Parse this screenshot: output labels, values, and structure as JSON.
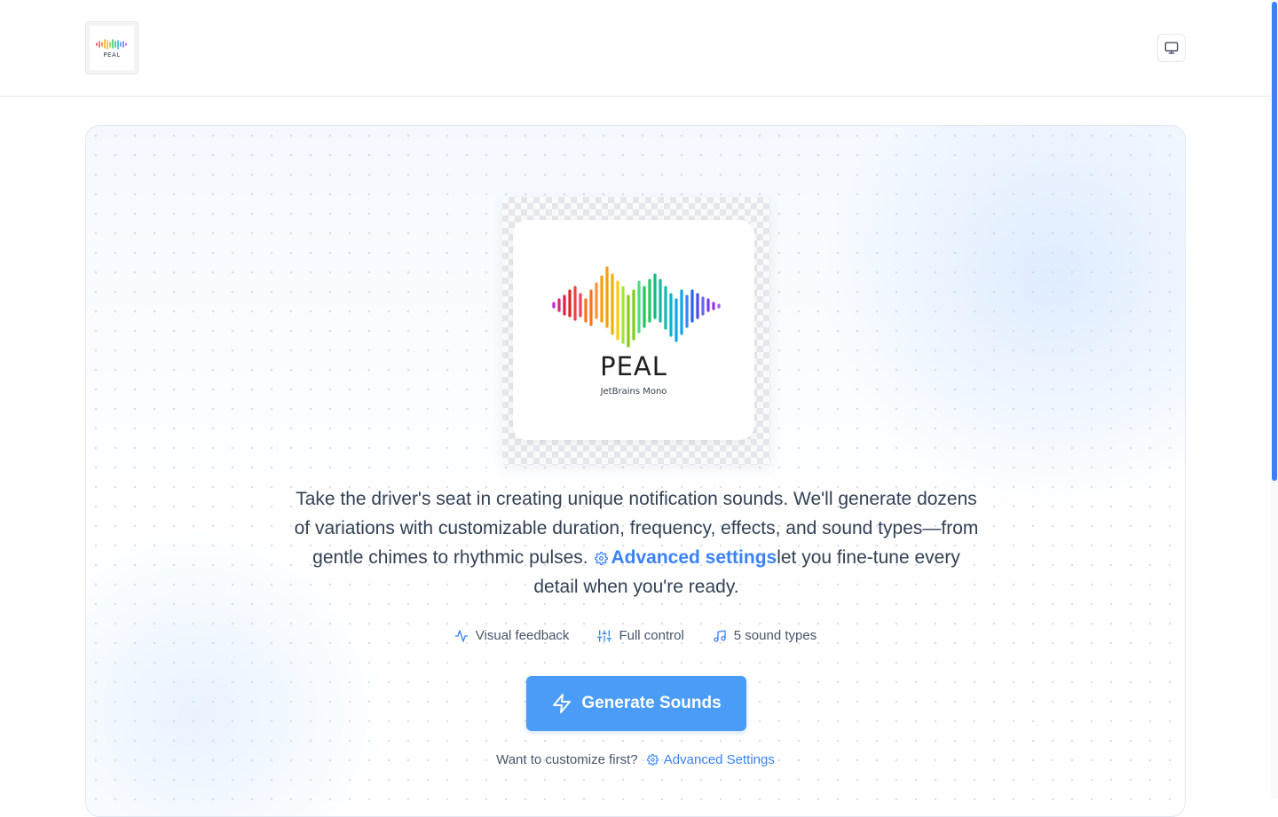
{
  "header": {
    "logo_icon": "peal-logo-thumbnail",
    "logo_text": "PEAL",
    "display_toggle_icon": "monitor-icon"
  },
  "hero": {
    "logo": {
      "wordmark": "PEAL",
      "font_caption": "JetBrains Mono",
      "icon": "rainbow-waveform-icon"
    },
    "description": {
      "part1": "Take the driver's seat in creating unique notification sounds. We'll generate dozens of variations with customizable duration, frequency, effects, and sound types—from gentle chimes to rhythmic pulses. ",
      "link_label": "Advanced settings",
      "part2": "let you fine-tune every detail when you're ready."
    },
    "features": [
      {
        "icon": "activity-icon",
        "label": "Visual feedback"
      },
      {
        "icon": "sliders-icon",
        "label": "Full control"
      },
      {
        "icon": "music-note-icon",
        "label": "5 sound types"
      }
    ],
    "generate_button": {
      "icon": "lightning-icon",
      "label": "Generate Sounds"
    },
    "customize_prompt": "Want to customize first?",
    "advanced_settings_link": "Advanced Settings"
  },
  "colors": {
    "accent": "#3b82f6",
    "button": "#4a9cf6",
    "text": "#334155"
  }
}
